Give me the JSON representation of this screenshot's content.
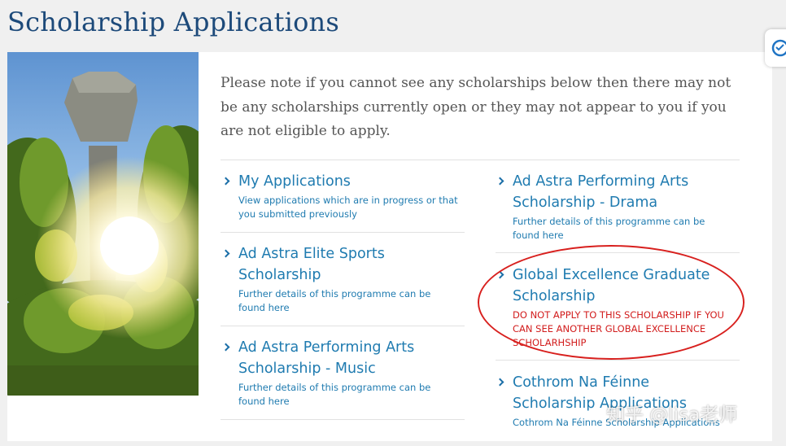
{
  "page": {
    "title": "Scholarship Applications"
  },
  "intro_text": "Please note if you cannot see any scholarships below then there may not be any scholarships currently open or they may not appear to you if you are not eligible to apply.",
  "left_column": [
    {
      "title": "My Applications",
      "description": "View applications which are in progress or that you submitted previously"
    },
    {
      "title": "Ad Astra Elite Sports Scholarship",
      "description": "Further details of this programme can be found here"
    },
    {
      "title": "Ad Astra Performing Arts Scholarship - Music",
      "description": "Further details of this programme can be found here"
    }
  ],
  "right_column": [
    {
      "title": "Ad Astra Performing Arts Scholarship - Drama",
      "description": "Further details of this programme can be found here"
    },
    {
      "title": "Global Excellence Graduate Scholarship",
      "description": "DO NOT APPLY TO THIS SCHOLARSHIP IF YOU CAN SEE ANOTHER GLOBAL EXCELLENCE SCHOLARHSHIP"
    },
    {
      "title": "Cothrom Na Féinne Scholarship Applications",
      "description": "Cothrom Na Féinne Scholarship Applications"
    }
  ],
  "watermark": "知乎 @lisa老师",
  "colors": {
    "title": "#1d4a7a",
    "link": "#1f7bb0",
    "warning": "#d21d1d",
    "annotation": "#d8201e"
  },
  "icons": [
    "chevron-right-icon",
    "translate-widget-icon"
  ]
}
